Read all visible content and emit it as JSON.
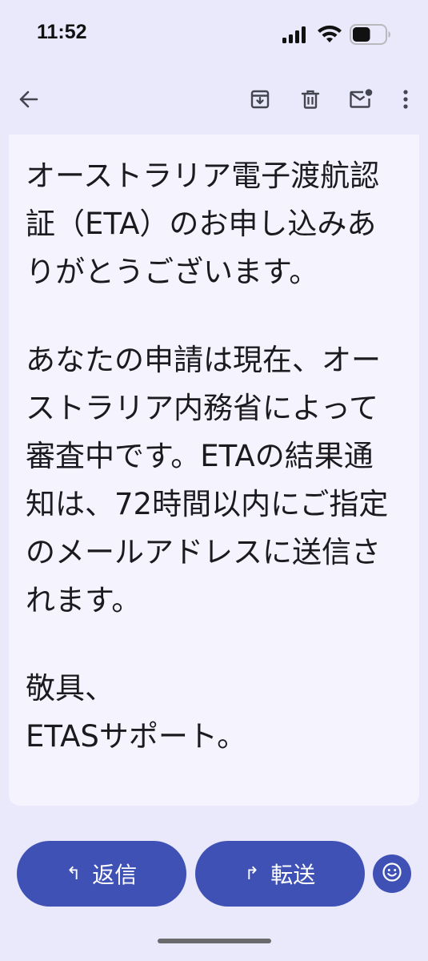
{
  "status_bar": {
    "time": "11:52",
    "icons": [
      "cellular-signal-icon",
      "wifi-icon",
      "battery-icon"
    ],
    "battery_level": 0.55
  },
  "toolbar": {
    "icons": [
      "back-arrow-icon",
      "archive-icon",
      "delete-icon",
      "mark-unread-icon",
      "more-options-icon"
    ]
  },
  "email": {
    "paragraph_1": "オーストラリア電子渡航認証（ETA）のお申し込みありがとうございます。",
    "paragraph_2": "あなたの申請は現在、オーストラリア内務省によって審査中です。ETAの結果通知は、72時間以内にご指定のメールアドレスに送信されます。",
    "closing": "敬具、",
    "signature": "ETASサポート。"
  },
  "actions": {
    "reply_label": "返信",
    "reply_icon": "↰",
    "forward_label": "転送",
    "forward_icon": "↱",
    "emoji_icon": "emoji-reaction-icon"
  },
  "colors": {
    "background": "#e9e9fb",
    "card": "#f5f4fe",
    "accent": "#3f51b5"
  }
}
